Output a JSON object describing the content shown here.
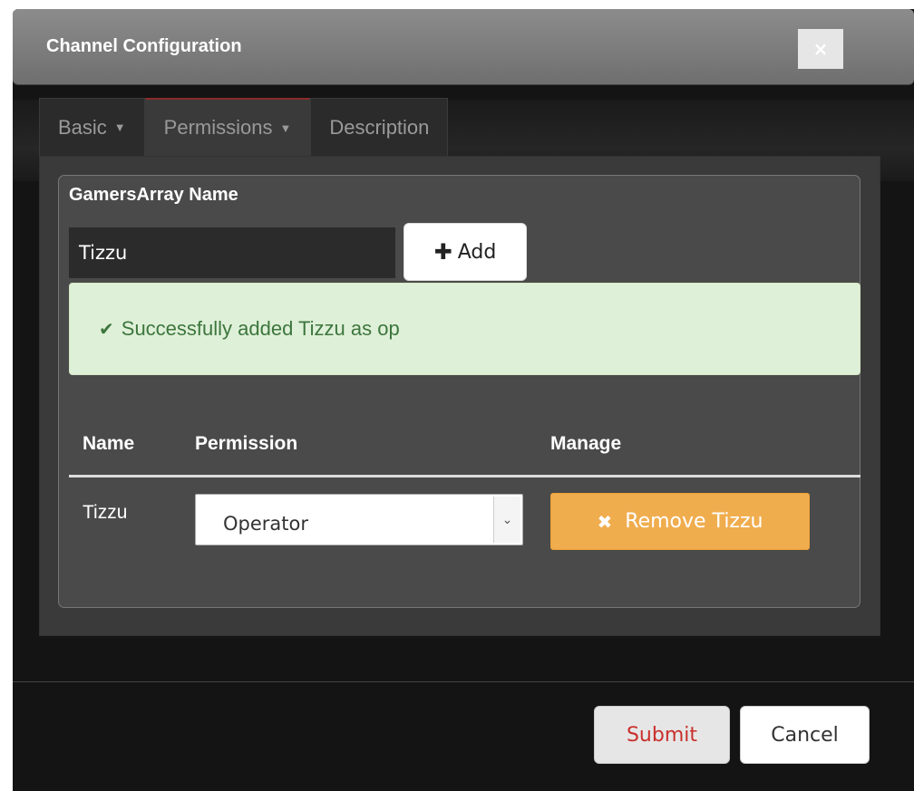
{
  "dialog": {
    "title": "Channel Configuration",
    "close_label": "×"
  },
  "tabs": [
    {
      "label": "Basic",
      "caret": "▼",
      "active": false
    },
    {
      "label": "Permissions",
      "caret": "▼",
      "active": true
    },
    {
      "label": "Description",
      "caret": "",
      "active": false
    }
  ],
  "panel": {
    "heading": "GamersArray Name",
    "input_value": "Tizzu",
    "add_button": {
      "icon": "plus-icon",
      "glyph": "✚",
      "label": "Add"
    },
    "alert": {
      "icon": "check-icon",
      "glyph": "✔",
      "text": "Successfully added Tizzu as op"
    }
  },
  "table": {
    "headers": [
      "Name",
      "Permission",
      "Manage"
    ],
    "rows": [
      {
        "name": "Tizzu",
        "permission": "Operator",
        "remove_label": "Remove Tizzu",
        "remove_glyph": "✖"
      }
    ]
  },
  "footer": {
    "submit_label": "Submit",
    "cancel_label": "Cancel"
  },
  "colors": {
    "alert_bg": "#dff0d8",
    "alert_text": "#3c763d",
    "warning": "#f0ad4e",
    "danger_text": "#c9302c"
  }
}
